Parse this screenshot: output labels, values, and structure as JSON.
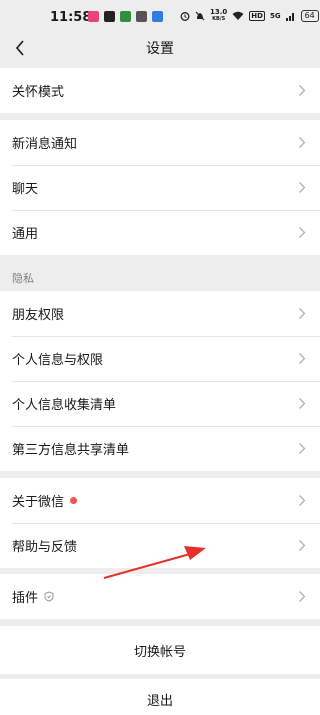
{
  "status_bar": {
    "time": "11:58",
    "net_speed_top": "13.0",
    "net_speed_bottom": "KB/S",
    "hd": "HD",
    "signal": "5G",
    "battery": "64"
  },
  "nav": {
    "title": "设置"
  },
  "groups": {
    "care": {
      "label": "关怀模式"
    },
    "notifications": {
      "label": "新消息通知"
    },
    "chat": {
      "label": "聊天"
    },
    "general": {
      "label": "通用"
    },
    "privacy_section": "隐私",
    "friend_permissions": {
      "label": "朋友权限"
    },
    "personal_info": {
      "label": "个人信息与权限"
    },
    "info_collection": {
      "label": "个人信息收集清单"
    },
    "third_party": {
      "label": "第三方信息共享清单"
    },
    "about": {
      "label": "关于微信"
    },
    "help": {
      "label": "帮助与反馈"
    },
    "plugins": {
      "label": "插件"
    },
    "switch_account": {
      "label": "切换帐号"
    },
    "logout": {
      "label": "退出"
    }
  },
  "colors": {
    "background": "#ededed",
    "cell": "#ffffff",
    "red_dot": "#fa5151",
    "annotation_arrow": "#e8302a"
  }
}
